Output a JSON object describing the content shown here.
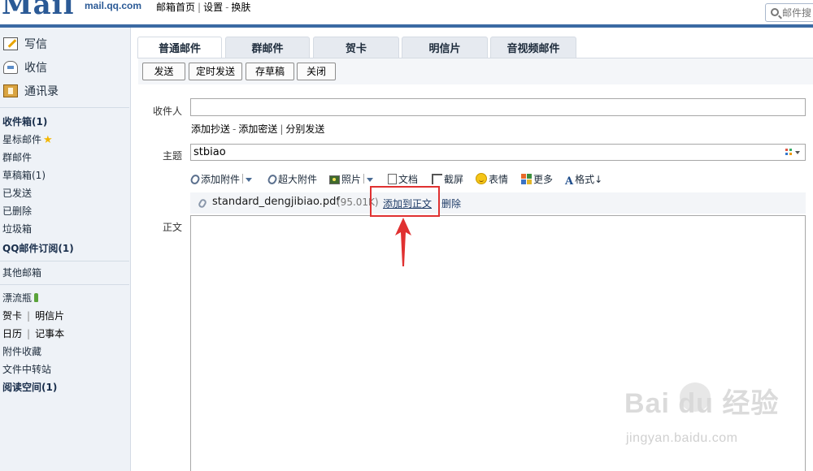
{
  "header": {
    "logo_mark": "Mail",
    "logo_domain": "mail.qq.com",
    "links": [
      "邮箱首页",
      "设置",
      "换肤"
    ],
    "search_placeholder": "邮件搜"
  },
  "sidebar": {
    "primary": [
      {
        "label": "写信",
        "icon": "write-icon"
      },
      {
        "label": "收信",
        "icon": "inbox-icon"
      },
      {
        "label": "通讯录",
        "icon": "contacts-icon"
      }
    ],
    "folders": [
      "收件箱(1)",
      "星标邮件",
      "群邮件",
      "草稿箱(1)",
      "已发送",
      "已删除",
      "垃圾箱",
      "QQ邮件订阅(1)"
    ],
    "other_mailbox": "其他邮箱",
    "apps": {
      "drift_bottle": "漂流瓶",
      "card": "贺卡",
      "postcard": "明信片",
      "calendar": "日历",
      "notes": "记事本",
      "attachments": "附件收藏",
      "file_transfer": "文件中转站",
      "reading_space": "阅读空间(1)"
    }
  },
  "compose": {
    "tabs": [
      "普通邮件",
      "群邮件",
      "贺卡",
      "明信片",
      "音视频邮件"
    ],
    "active_tab": 0,
    "toolbar": [
      "发送",
      "定时发送",
      "存草稿",
      "关闭"
    ],
    "recipient_label": "收件人",
    "recipient_value": "",
    "cc_links": {
      "add_cc": "添加抄送",
      "dash": "-",
      "add_bcc": "添加密送",
      "separate": "分别发送"
    },
    "subject_label": "主题",
    "subject_value": "stbiao",
    "edit_tools": [
      "添加附件",
      "超大附件",
      "照片",
      "文档",
      "截屏",
      "表情",
      "更多",
      "格式"
    ],
    "attachment": {
      "name": "standard_dengjibiao.pdf",
      "size": "(95.01K)",
      "add_to_body": "添加到正文",
      "delete": "删除"
    },
    "body_label": "正文"
  },
  "watermark": {
    "logo": "Bai  du 经验",
    "url": "jingyan.baidu.com"
  },
  "colors": {
    "accent": "#3b6aa3",
    "highlight": "#e03131",
    "sidebar_bg": "#eef2f7"
  }
}
